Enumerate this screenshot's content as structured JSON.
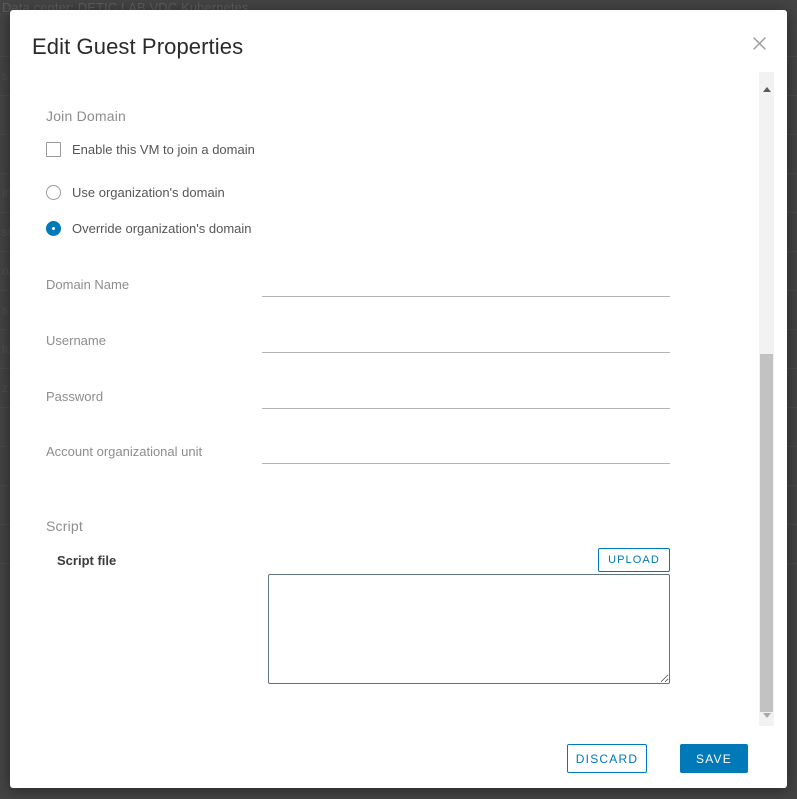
{
  "background": {
    "breadcrumb": "Data center: DETIC LAB VDC Kubernetes",
    "rows": [
      "",
      "s",
      "",
      "",
      "in",
      "st",
      "oa",
      "s",
      "to",
      "z",
      "",
      "",
      "",
      ""
    ]
  },
  "modal": {
    "title": "Edit Guest Properties",
    "close_icon": "close-icon",
    "sections": {
      "join_domain": {
        "title": "Join Domain",
        "enable_checkbox": {
          "label": "Enable this VM to join a domain",
          "checked": false
        },
        "radios": [
          {
            "label": "Use organization's domain",
            "checked": false
          },
          {
            "label": "Override organization's domain",
            "checked": true
          }
        ],
        "fields": [
          {
            "label": "Domain Name",
            "value": "",
            "placeholder": ""
          },
          {
            "label": "Username",
            "value": "",
            "placeholder": ""
          },
          {
            "label": "Password",
            "value": "",
            "placeholder": ""
          },
          {
            "label": "Account organizational unit",
            "value": "",
            "placeholder": ""
          }
        ]
      },
      "script": {
        "title": "Script",
        "file_label": "Script file",
        "upload_label": "UPLOAD",
        "textarea_value": "",
        "textarea_placeholder": ""
      }
    },
    "scrollbar": {
      "up_icon": "triangle-up-icon",
      "down_icon": "triangle-down-icon"
    },
    "footer": {
      "discard_label": "DISCARD",
      "save_label": "SAVE"
    }
  },
  "colors": {
    "accent": "#0079b8",
    "backdrop": "#444444",
    "label": "#8d8d8d",
    "textarea_border": "#60757f"
  }
}
